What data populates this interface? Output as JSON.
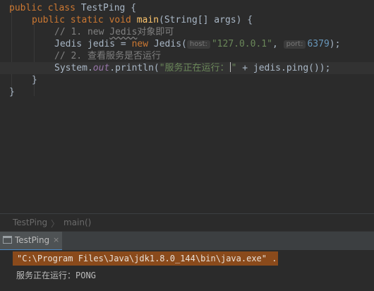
{
  "editor": {
    "line1": {
      "kw": "public class ",
      "name": "TestPing",
      "rest": " {"
    },
    "line2": {
      "kw": "public static void ",
      "name": "main",
      "p1": "(",
      "type": "String",
      "p2": "[] args) {"
    },
    "line3": {
      "comment": "// 1. new ",
      "squiggle": "Jedis",
      "comment_rest": "对象即可"
    },
    "line4": {
      "type": "Jedis",
      "var": " jedis = ",
      "kw": "new ",
      "ctor": "Jedis",
      "open": "(",
      "hint_host": "host:",
      "host": "\"127.0.0.1\"",
      "comma": ", ",
      "hint_port": "port:",
      "port": "6379",
      "close": ");"
    },
    "line5": {
      "comment": "// 2. 查看服务是否运行"
    },
    "line6": {
      "cls": "System",
      "dot1": ".",
      "field": "out",
      "dot2": ".",
      "method": "println",
      "open": "(",
      "str_a": "\"服务正在运行：",
      "str_b": "\"",
      "plus": " + jedis.",
      "call": "ping",
      "close": "());"
    },
    "line7": {
      "text": "}"
    },
    "line8": {
      "text": "}"
    }
  },
  "breadcrumbs": {
    "class_name": "TestPing",
    "method_name": "main()",
    "separator": "〉"
  },
  "run_panel": {
    "tab_label": "TestPing",
    "close_glyph": "×",
    "command": "\"C:\\Program Files\\Java\\jdk1.8.0_144\\bin\\java.exe\" ...",
    "output": "服务正在运行：PONG"
  }
}
